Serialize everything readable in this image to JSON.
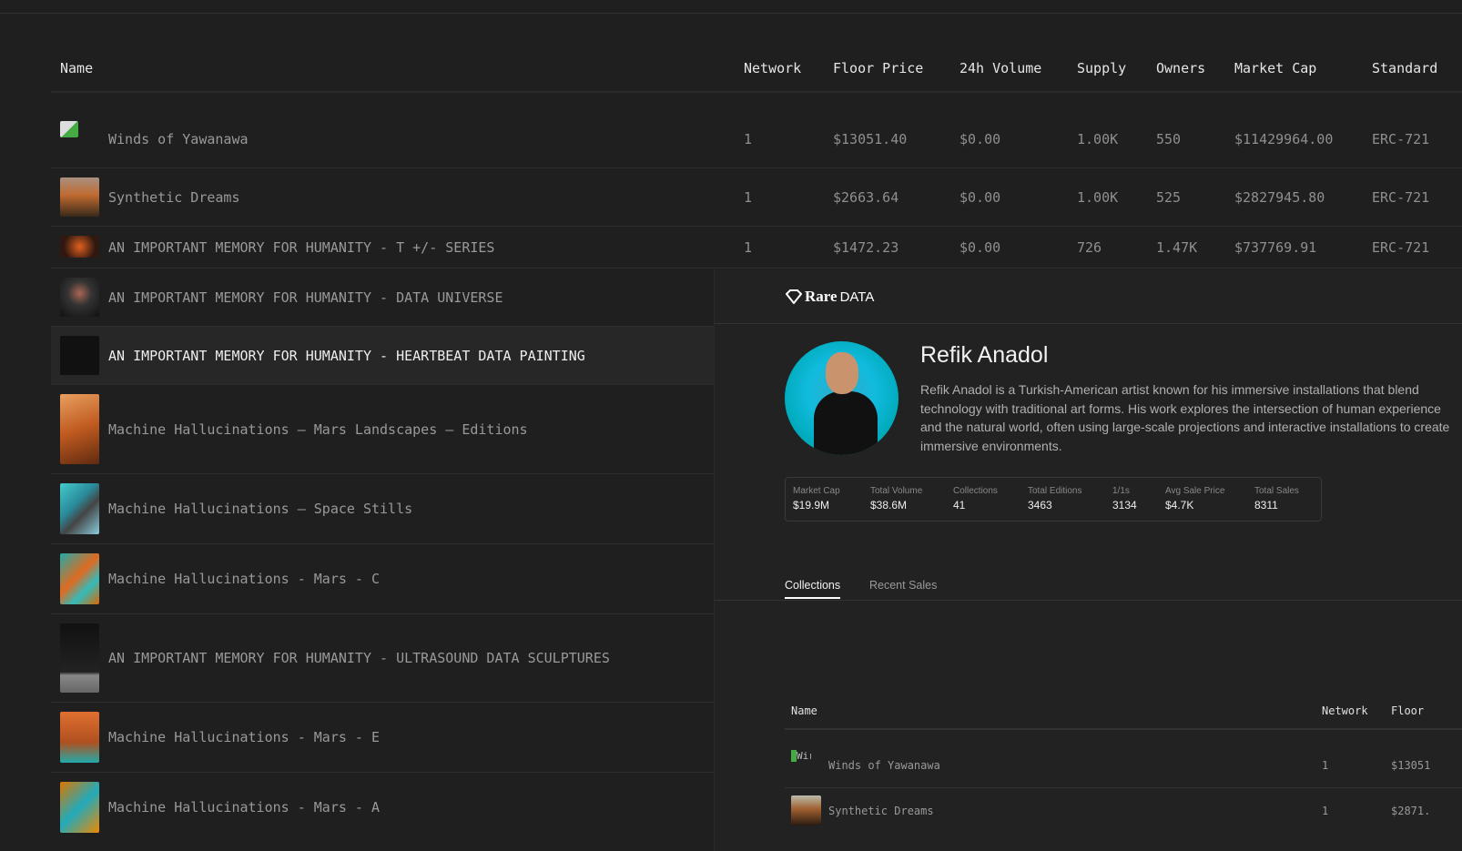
{
  "table": {
    "headers": [
      "Name",
      "Network",
      "Floor Price",
      "24h Volume",
      "Supply",
      "Owners",
      "Market Cap",
      "Standard"
    ],
    "rows": [
      {
        "name": "Winds of Yawanawa",
        "network": "1",
        "floor": "$13051.40",
        "volume": "$0.00",
        "supply": "1.00K",
        "owners": "550",
        "mcap": "$11429964.00",
        "standard": "ERC-721"
      },
      {
        "name": "Synthetic Dreams",
        "network": "1",
        "floor": "$2663.64",
        "volume": "$0.00",
        "supply": "1.00K",
        "owners": "525",
        "mcap": "$2827945.80",
        "standard": "ERC-721"
      },
      {
        "name": "AN IMPORTANT MEMORY FOR HUMANITY - T +/- SERIES",
        "network": "1",
        "floor": "$1472.23",
        "volume": "$0.00",
        "supply": "726",
        "owners": "1.47K",
        "mcap": "$737769.91",
        "standard": "ERC-721"
      },
      {
        "name": "AN IMPORTANT MEMORY FOR HUMANITY - DATA UNIVERSE"
      },
      {
        "name": "AN IMPORTANT MEMORY FOR HUMANITY - HEARTBEAT DATA PAINTING"
      },
      {
        "name": "Machine Hallucinations — Mars Landscapes — Editions"
      },
      {
        "name": "Machine Hallucinations – Space Stills"
      },
      {
        "name": "Machine Hallucinations - Mars - C"
      },
      {
        "name": "AN IMPORTANT MEMORY FOR HUMANITY - ULTRASOUND DATA SCULPTURES"
      },
      {
        "name": "Machine Hallucinations - Mars - E"
      },
      {
        "name": "Machine Hallucinations - Mars - A"
      }
    ]
  },
  "panel": {
    "logo": {
      "rare": "Rare",
      "data": "DATA"
    },
    "artist_name": "Refik Anadol",
    "bio": [
      "Refik Anadol is a Turkish-American artist known for his immersive installations that blend",
      "technology with traditional art forms. His work explores the intersection of human experience",
      "and the natural world, often using large-scale projections and interactive installations to create",
      "immersive environments."
    ],
    "stats": [
      {
        "label": "Market Cap",
        "value": "$19.9M"
      },
      {
        "label": "Total Volume",
        "value": "$38.6M"
      },
      {
        "label": "Collections",
        "value": "41"
      },
      {
        "label": "Total Editions",
        "value": "3463"
      },
      {
        "label": "1/1s",
        "value": "3134"
      },
      {
        "label": "Avg Sale Price",
        "value": "$4.7K"
      },
      {
        "label": "Total Sales",
        "value": "8311"
      }
    ],
    "tabs": [
      "Collections",
      "Recent Sales"
    ],
    "sub_table": {
      "headers": [
        "Name",
        "Network",
        "Floor"
      ],
      "broken_img_alt": "Wir",
      "rows": [
        {
          "name": "Winds of Yawanawa",
          "network": "1",
          "floor": "$13051"
        },
        {
          "name": "Synthetic Dreams",
          "network": "1",
          "floor": "$2871."
        }
      ]
    }
  }
}
